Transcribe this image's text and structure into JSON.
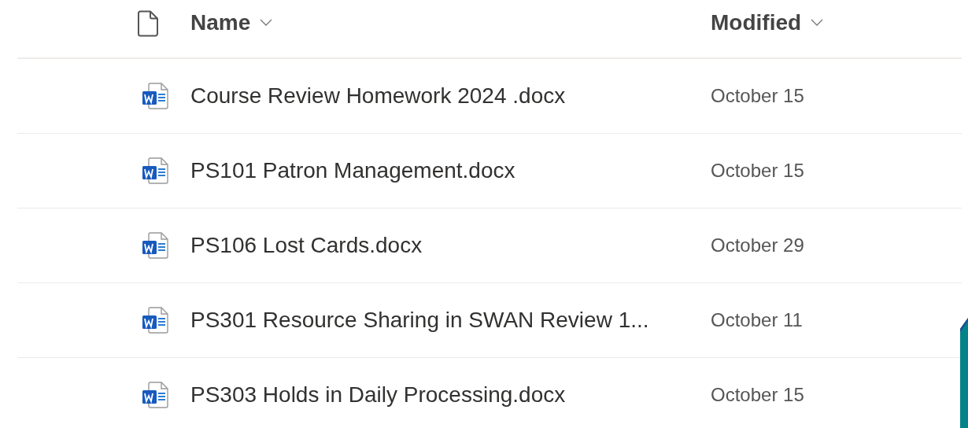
{
  "table": {
    "columns": [
      {
        "label": "Name",
        "sortable": true
      },
      {
        "label": "Modified",
        "sortable": true
      }
    ],
    "rows": [
      {
        "name": "Course Review Homework 2024 .docx",
        "modified": "October 15"
      },
      {
        "name": "PS101 Patron Management.docx",
        "modified": "October 15"
      },
      {
        "name": "PS106 Lost Cards.docx",
        "modified": "October 29"
      },
      {
        "name": "PS301 Resource Sharing in SWAN Review 1...",
        "modified": "October 11"
      },
      {
        "name": "PS303 Holds in Daily Processing.docx",
        "modified": "October 15"
      }
    ]
  }
}
